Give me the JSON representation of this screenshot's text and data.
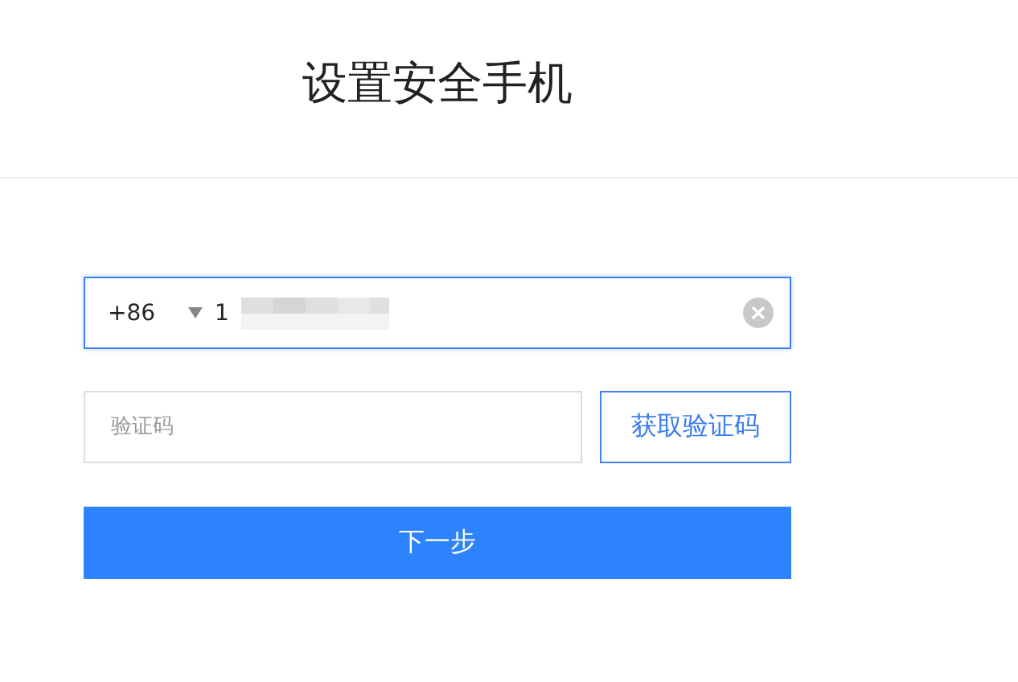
{
  "header": {
    "title": "设置安全手机"
  },
  "phone": {
    "country_code": "+86",
    "value": "1",
    "focused": true
  },
  "code": {
    "placeholder": "验证码"
  },
  "get_code_button": {
    "label": "获取验证码"
  },
  "next_button": {
    "label": "下一步"
  }
}
